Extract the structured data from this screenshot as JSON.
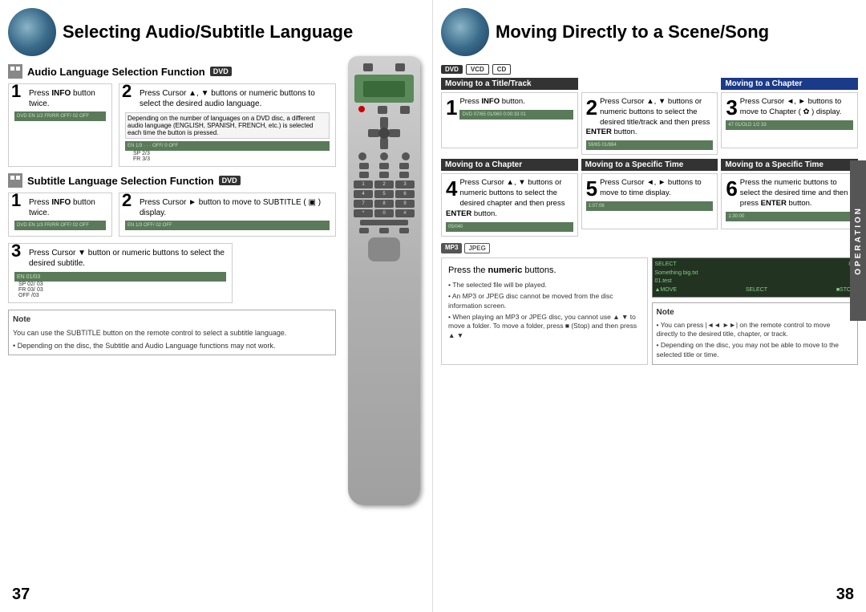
{
  "left": {
    "header_title": "Selecting Audio/Subtitle Language",
    "audio_section": {
      "title": "Audio Language Selection Function",
      "badge": "DVD",
      "step1": {
        "num": "1",
        "text": "Press ",
        "bold": "INFO",
        "text2": " button twice."
      },
      "step2": {
        "num": "2",
        "text": "Press Cursor ▲, ▼ buttons or numeric buttons to select the desired audio language."
      },
      "note": "Depending on the number of languages on a DVD disc, a different audio language (ENGLISH, SPANISH, FRENCH, etc.) is selected each time the button is pressed.",
      "screen1_text": "DVD  EN 1/2  FR/RR  OFF/ 02  OFF",
      "screen2_text": "EN 1/3 · · · OFF/ 0  OFF",
      "screen2b": "SP 2/3",
      "screen2c": "FR 3/3"
    },
    "subtitle_section": {
      "title": "Subtitle Language Selection Function",
      "badge": "DVD",
      "step1": {
        "num": "1",
        "text": "Press ",
        "bold": "INFO",
        "text2": " button twice."
      },
      "step2": {
        "num": "2",
        "text": "Press Cursor ► button to move to SUBTITLE ( ▣ ) display."
      },
      "screen1_text": "DVD  EN 1/3  FR/RR  OFF/ 02  OFF",
      "screen2_text": "EN 1/3  OFF/ 02  OFF",
      "step3": {
        "num": "3",
        "text": "Press Cursor ▼ button or numeric buttons to select the desired subtitle."
      },
      "screen3_text": "EN 01/03",
      "screen3b": "SP 02/ 03",
      "screen3c": "FR 03/ 03",
      "screen3d": "OFF /03"
    },
    "note": {
      "title": "Note",
      "lines": [
        "You can use the SUBTITLE button on the remote control to select a subtitle language.",
        "Depending on the disc, the Subtitle and Audio Language functions may not work."
      ]
    },
    "page_num": "37"
  },
  "right": {
    "header_title": "Moving Directly to a Scene/Song",
    "disc_badges": [
      "DVD",
      "VCD",
      "CD"
    ],
    "title_track_header": "Moving to a Title/Track",
    "chapter_header": "Moving to a Chapter",
    "step1": {
      "num": "1",
      "text": "Press ",
      "bold": "INFO",
      "text2": " button."
    },
    "step2": {
      "num": "2",
      "text": "Press Cursor ▲, ▼ buttons or numeric buttons to select the desired title/track and then press ",
      "bold2": "ENTER",
      "text3": " button."
    },
    "step3": {
      "num": "3",
      "text": "Press Cursor ◄, ► buttons to move to Chapter ( ✿ ) display."
    },
    "chapter_header2": "Moving to a Chapter",
    "specific_time_header": "Moving to a Specific Time",
    "specific_time_header2": "Moving to a Specific Time",
    "step4": {
      "num": "4",
      "text": "Press Cursor ▲, ▼ buttons or numeric buttons to select the desired chapter and then press ",
      "bold": "ENTER",
      "text2": " button."
    },
    "step5": {
      "num": "5",
      "text": "Press Cursor ◄, ► buttons to move to time display."
    },
    "step6": {
      "num": "6",
      "text": "Press the numeric buttons to select the desired time and then press ",
      "bold": "ENTER",
      "text2": " button."
    },
    "screen1": "DVD  07/65  01/060  0:00:33  01",
    "screen2": "59/65  01/884",
    "screen3": "47  01/OLD  1/2  33",
    "screen4": "05/040",
    "screen5": "1:07:06",
    "screen6": "1:30:00",
    "mp3_jpeg_badges": [
      "MP3",
      "JPEG"
    ],
    "mp3_step": {
      "text": "Press the ",
      "bold": "numeric",
      "text2": " buttons."
    },
    "mp3_bullets": [
      "The selected file will be played.",
      "An MP3 or JPEG disc cannot be moved from the disc information screen.",
      "When playing an MP3 or JPEG disc, you cannot use ▲ ▼ to move a folder. To move a folder, press ■ (Stop) and then press ▲ ▼"
    ],
    "note": {
      "title": "Note",
      "lines": [
        "You can press |◄◄ ►►| on the remote control to move directly to the desired title, chapter, or track.",
        "Depending on the disc, you may not be able to move to the selected title or time."
      ]
    },
    "operation_label": "OPERATION",
    "page_num": "38"
  }
}
